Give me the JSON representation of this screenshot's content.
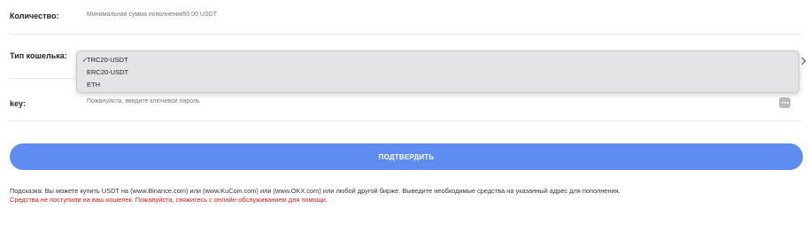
{
  "amount": {
    "label": "Количество:",
    "placeholder": "Минимальная сумма пополнения50.00 USDT"
  },
  "wallet": {
    "label": "Тип кошелька:",
    "selected": "TRC20-USDT",
    "options": [
      {
        "check": "✓",
        "label": "TRC20-USDT"
      },
      {
        "check": "",
        "label": "ERC20-USDT"
      },
      {
        "check": "",
        "label": "ETH"
      }
    ]
  },
  "key": {
    "label": "key:",
    "placeholder": "Пожалуйста, введите ключевой пароль",
    "toggle_icon": "eye-toggle-icon"
  },
  "confirm_button": "ПОДТВЕРДИТЬ",
  "hint": "Подсказка: Вы можете купить USDT на (www.Binance.com) или (www.KuCoin.com) или (www.OKX.com) или любой другой бирже. Выведите необходимые средства на указанный адрес для пополнения.",
  "error": "Средства не поступили на ваш кошелек. Пожалуйста, свяжитесь с онлайн-обслуживанием для помощи.",
  "colors": {
    "accent": "#5f8cf1",
    "error": "#e01b1b"
  }
}
